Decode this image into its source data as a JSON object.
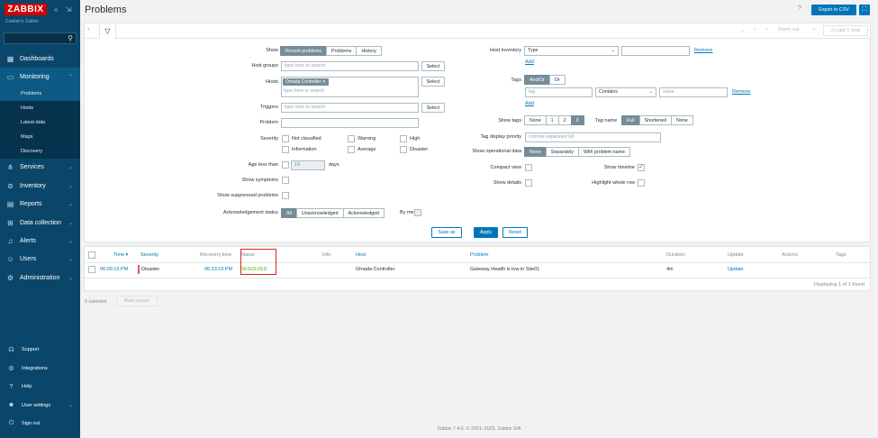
{
  "sidebar": {
    "logo": "ZABBIX",
    "subtitle": "Coelian's Zabbix",
    "menu": [
      {
        "label": "Dashboards"
      },
      {
        "label": "Monitoring"
      },
      {
        "label": "Services"
      },
      {
        "label": "Inventory"
      },
      {
        "label": "Reports"
      },
      {
        "label": "Data collection"
      },
      {
        "label": "Alerts"
      },
      {
        "label": "Users"
      },
      {
        "label": "Administration"
      }
    ],
    "monitoring_sub": [
      "Problems",
      "Hosts",
      "Latest data",
      "Maps",
      "Discovery"
    ],
    "bottom": [
      "Support",
      "Integrations",
      "Help",
      "User settings",
      "Sign out"
    ]
  },
  "header": {
    "title": "Problems",
    "help": "?",
    "export_label": "Export to CSV"
  },
  "filterbar": {
    "zoom_out": "Zoom out",
    "last": "Last 1 hour"
  },
  "filter": {
    "show_label": "Show",
    "show_options": [
      "Recent problems",
      "Problems",
      "History"
    ],
    "host_groups_label": "Host groups",
    "host_groups_placeholder": "type here to search",
    "select_label": "Select",
    "hosts_label": "Hosts",
    "hosts_chip": "Omada Controller",
    "hosts_placeholder": "type here to search",
    "triggers_label": "Triggers",
    "triggers_placeholder": "type here to search",
    "problem_label": "Problem",
    "severity_label": "Severity",
    "severities": [
      "Not classified",
      "Warning",
      "High",
      "Information",
      "Average",
      "Disaster"
    ],
    "age_label": "Age less than",
    "age_value": "14",
    "age_unit": "days",
    "show_symptoms_label": "Show symptoms",
    "show_suppressed_label": "Show suppressed problems",
    "ack_label": "Acknowledgement status",
    "ack_options": [
      "All",
      "Unacknowledged",
      "Acknowledged"
    ],
    "by_me": "By me",
    "host_inventory_label": "Host inventory",
    "host_inventory_select": "Type",
    "remove": "Remove",
    "add": "Add",
    "tags_label": "Tags",
    "tags_mode": [
      "And/Or",
      "Or"
    ],
    "tag_placeholder": "tag",
    "tag_op": "Contains",
    "value_placeholder": "value",
    "show_tags_label": "Show tags",
    "show_tags_options": [
      "None",
      "1",
      "2",
      "3"
    ],
    "tag_name_label": "Tag name",
    "tag_name_options": [
      "Full",
      "Shortened",
      "None"
    ],
    "tag_priority_label": "Tag display priority",
    "tag_priority_placeholder": "comma-separated list",
    "op_data_label": "Show operational data",
    "op_data_options": [
      "None",
      "Separately",
      "With problem name"
    ],
    "compact_label": "Compact view",
    "timeline_label": "Show timeline",
    "details_label": "Show details",
    "highlight_label": "Highlight whole row",
    "save_as": "Save as",
    "apply": "Apply",
    "reset": "Reset"
  },
  "table": {
    "headers": {
      "time": "Time ▾",
      "severity": "Severity",
      "recovery": "Recovery time",
      "status": "Status",
      "info": "Info",
      "host": "Host",
      "problem": "Problem",
      "duration": "Duration",
      "update": "Update",
      "actions": "Actions",
      "tags": "Tags"
    },
    "row": {
      "time": "06:09:19 PM",
      "severity": "Disaster",
      "recovery": "06:13:19 PM",
      "status": "RESOLVED",
      "host": "Omada Controller",
      "problem": "Gateway Health is low in Site01",
      "duration": "4m",
      "update": "Update"
    },
    "displaying": "Displaying 1 of 1 found"
  },
  "mass": {
    "selected": "0 selected",
    "mass_update": "Mass update"
  },
  "footer": "Zabbix 7.4.6. © 2001–2025, Zabbix SIA",
  "colors": {
    "sidebar": "#0a466a",
    "accent": "#0275b8",
    "logo": "#d40000",
    "resolved": "#59b300",
    "disaster": "#e45959"
  }
}
